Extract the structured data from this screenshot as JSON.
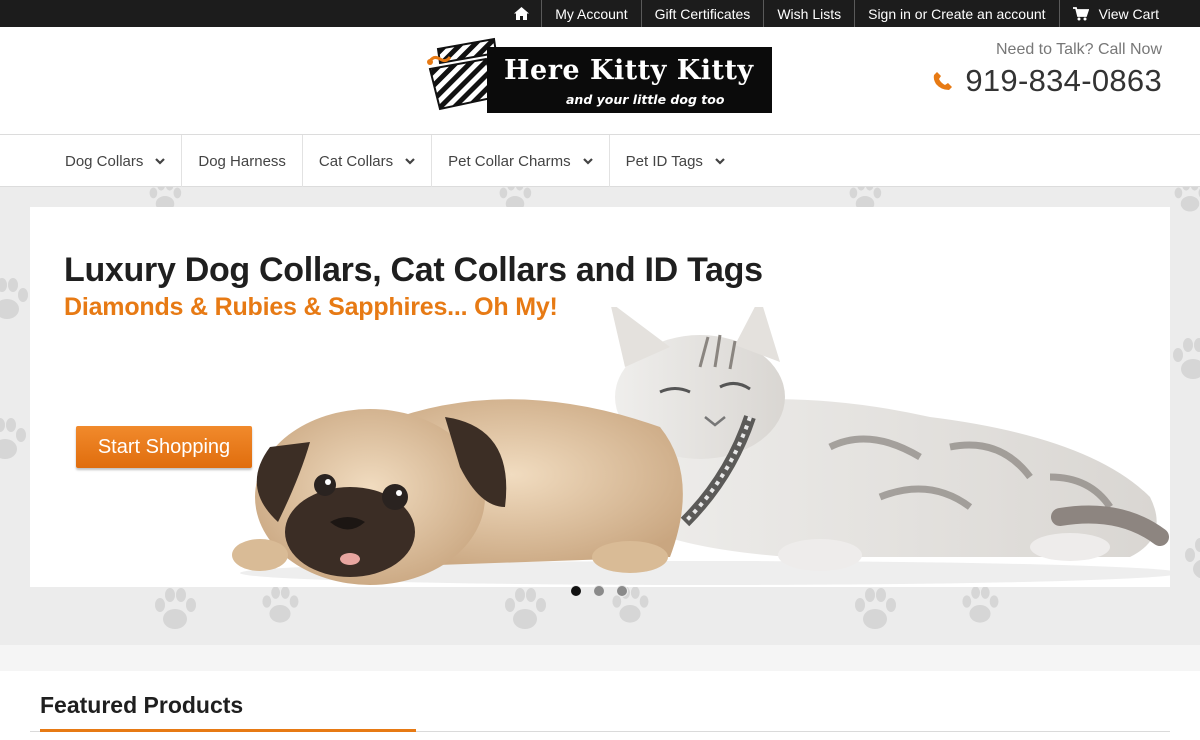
{
  "topbar": {
    "items": [
      {
        "label": "",
        "icon": "home-icon"
      },
      {
        "label": "My Account"
      },
      {
        "label": "Gift Certificates"
      },
      {
        "label": "Wish Lists"
      },
      {
        "label": "Sign in or Create an account"
      },
      {
        "label": "View Cart",
        "icon": "cart-icon"
      }
    ]
  },
  "header": {
    "logo_title": "Here Kitty Kitty",
    "logo_tagline": "and your little dog too",
    "contact_label": "Need to Talk? Call Now",
    "phone": "919-834-0863"
  },
  "nav": {
    "items": [
      {
        "label": "Dog Collars",
        "has_dropdown": true
      },
      {
        "label": "Dog Harness",
        "has_dropdown": false
      },
      {
        "label": "Cat Collars",
        "has_dropdown": true
      },
      {
        "label": "Pet Collar Charms",
        "has_dropdown": true
      },
      {
        "label": "Pet ID Tags",
        "has_dropdown": true
      }
    ]
  },
  "hero": {
    "title": "Luxury Dog Collars, Cat Collars and ID Tags",
    "subtitle": "Diamonds & Rubies & Sapphires... Oh My!",
    "cta_label": "Start Shopping",
    "slide_count": 3,
    "active_slide": 1
  },
  "featured": {
    "title": "Featured Products"
  },
  "colors": {
    "accent": "#e77a14",
    "topbar_bg": "#1c1c1c",
    "hero_bg": "#ececec"
  }
}
